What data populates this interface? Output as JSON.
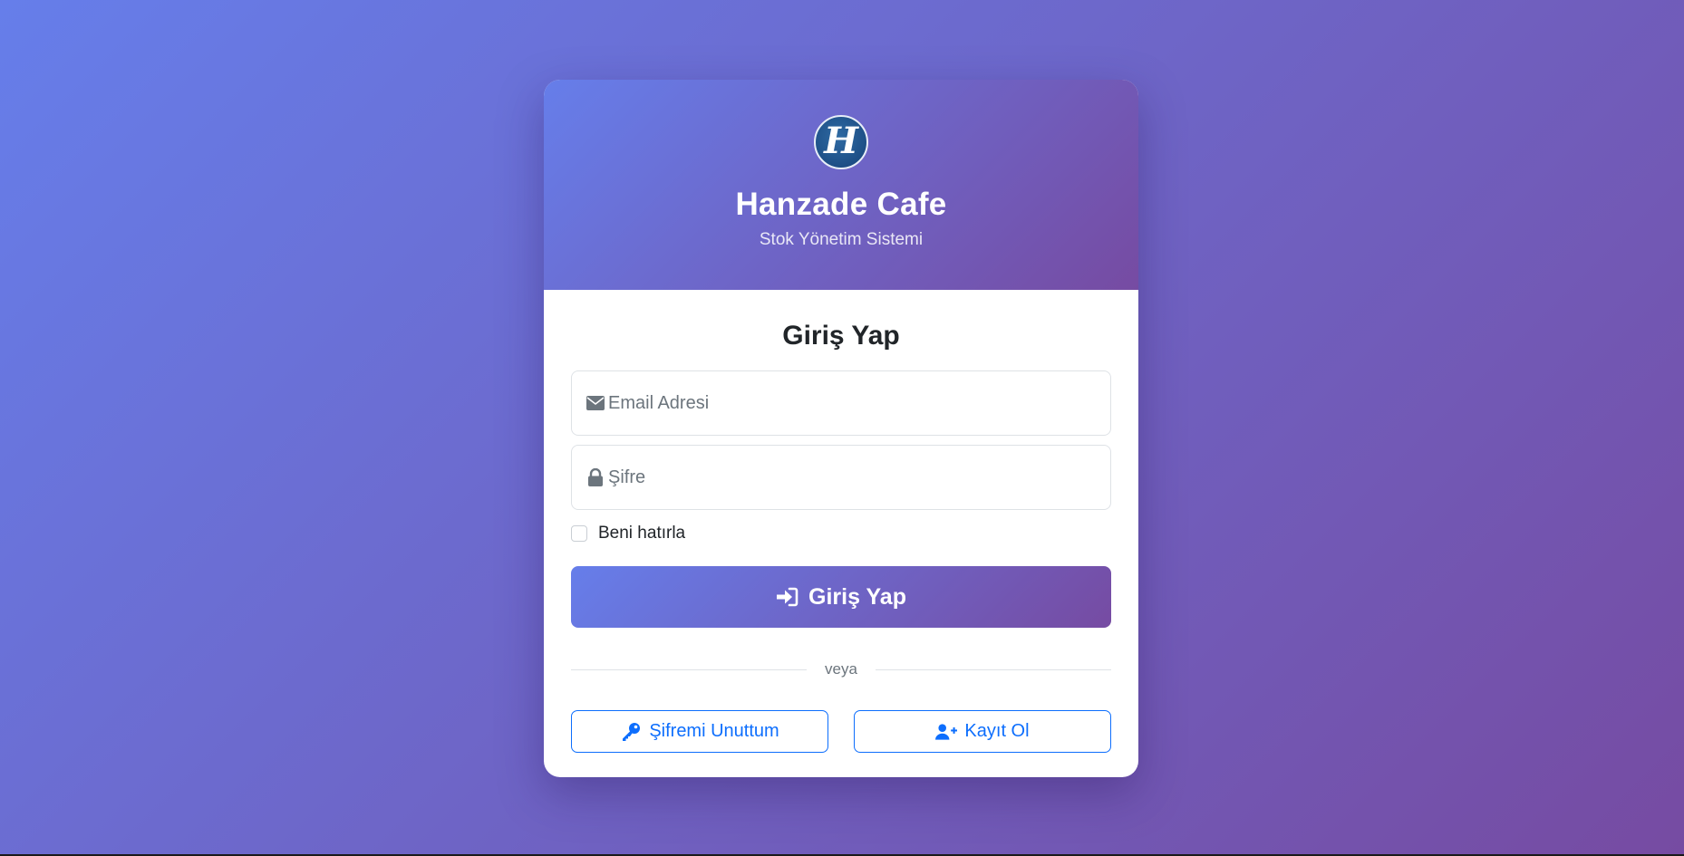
{
  "brand": {
    "logo_letter": "H",
    "title": "Hanzade Cafe",
    "subtitle": "Stok Yönetim Sistemi"
  },
  "form": {
    "title": "Giriş Yap",
    "email": {
      "placeholder": "Email Adresi",
      "value": "",
      "icon": "envelope-icon"
    },
    "password": {
      "placeholder": "Şifre",
      "value": "",
      "icon": "lock-icon"
    },
    "remember_label": "Beni hatırla",
    "remember_checked": false,
    "submit_label": "Giriş Yap",
    "submit_icon": "sign-in-icon"
  },
  "divider_text": "veya",
  "actions": {
    "forgot_label": "Şifremi Unuttum",
    "forgot_icon": "key-icon",
    "register_label": "Kayıt Ol",
    "register_icon": "user-plus-icon"
  },
  "colors": {
    "gradient_start": "#667eea",
    "gradient_end": "#764ba2",
    "link_blue": "#0d6efd",
    "text_dark": "#212529",
    "text_muted": "#6c757d"
  }
}
